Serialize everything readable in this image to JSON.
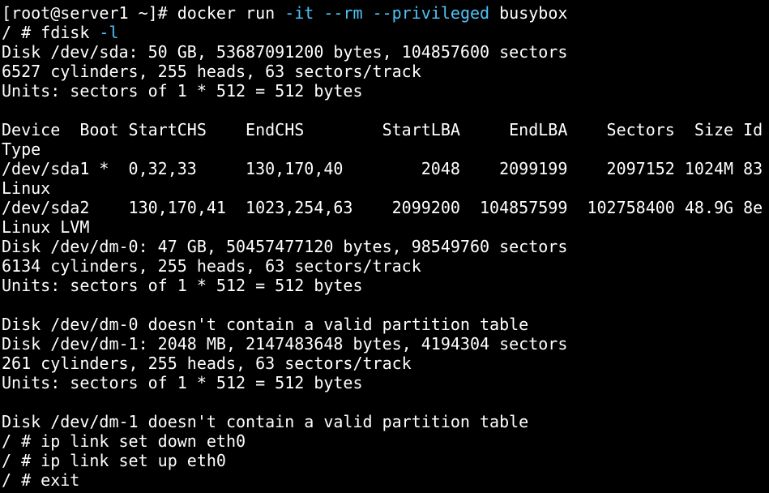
{
  "window": {
    "title": "",
    "background": "#000000",
    "foreground": "#ffffff",
    "accent": "#4fc3f7"
  },
  "terminal": {
    "lines": [
      {
        "segments": [
          {
            "text": "[root@server1 ~]# docker run ",
            "style": "normal"
          },
          {
            "text": "-it --rm --privileged",
            "style": "flag"
          },
          {
            "text": " busybox",
            "style": "normal"
          }
        ]
      },
      {
        "segments": [
          {
            "text": "/ # fdisk ",
            "style": "normal"
          },
          {
            "text": "-l",
            "style": "flag"
          }
        ]
      },
      {
        "segments": [
          {
            "text": "Disk /dev/sda: 50 GB, 53687091200 bytes, 104857600 sectors",
            "style": "normal"
          }
        ]
      },
      {
        "segments": [
          {
            "text": "6527 cylinders, 255 heads, 63 sectors/track",
            "style": "normal"
          }
        ]
      },
      {
        "segments": [
          {
            "text": "Units: sectors of 1 * 512 = 512 bytes",
            "style": "normal"
          }
        ]
      },
      {
        "segments": [
          {
            "text": "",
            "style": "normal"
          }
        ]
      },
      {
        "segments": [
          {
            "text": "Device  Boot StartCHS    EndCHS        StartLBA     EndLBA    Sectors  Size Id",
            "style": "normal"
          }
        ]
      },
      {
        "segments": [
          {
            "text": "Type",
            "style": "normal"
          }
        ]
      },
      {
        "segments": [
          {
            "text": "/dev/sda1 *  0,32,33     130,170,40        2048    2099199    2097152 1024M 83",
            "style": "normal"
          }
        ]
      },
      {
        "segments": [
          {
            "text": "Linux",
            "style": "normal"
          }
        ]
      },
      {
        "segments": [
          {
            "text": "/dev/sda2    130,170,41  1023,254,63    2099200  104857599  102758400 48.9G 8e",
            "style": "normal"
          }
        ]
      },
      {
        "segments": [
          {
            "text": "Linux LVM",
            "style": "normal"
          }
        ]
      },
      {
        "segments": [
          {
            "text": "Disk /dev/dm-0: 47 GB, 50457477120 bytes, 98549760 sectors",
            "style": "normal"
          }
        ]
      },
      {
        "segments": [
          {
            "text": "6134 cylinders, 255 heads, 63 sectors/track",
            "style": "normal"
          }
        ]
      },
      {
        "segments": [
          {
            "text": "Units: sectors of 1 * 512 = 512 bytes",
            "style": "normal"
          }
        ]
      },
      {
        "segments": [
          {
            "text": "",
            "style": "normal"
          }
        ]
      },
      {
        "segments": [
          {
            "text": "Disk /dev/dm-0 doesn't contain a valid partition table",
            "style": "normal"
          }
        ]
      },
      {
        "segments": [
          {
            "text": "Disk /dev/dm-1: 2048 MB, 2147483648 bytes, 4194304 sectors",
            "style": "normal"
          }
        ]
      },
      {
        "segments": [
          {
            "text": "261 cylinders, 255 heads, 63 sectors/track",
            "style": "normal"
          }
        ]
      },
      {
        "segments": [
          {
            "text": "Units: sectors of 1 * 512 = 512 bytes",
            "style": "normal"
          }
        ]
      },
      {
        "segments": [
          {
            "text": "",
            "style": "normal"
          }
        ]
      },
      {
        "segments": [
          {
            "text": "Disk /dev/dm-1 doesn't contain a valid partition table",
            "style": "normal"
          }
        ]
      },
      {
        "segments": [
          {
            "text": "/ # ip link set down eth0",
            "style": "normal"
          }
        ]
      },
      {
        "segments": [
          {
            "text": "/ # ip link set up eth0",
            "style": "normal"
          }
        ]
      },
      {
        "segments": [
          {
            "text": "/ # exit",
            "style": "normal"
          }
        ]
      }
    ]
  }
}
